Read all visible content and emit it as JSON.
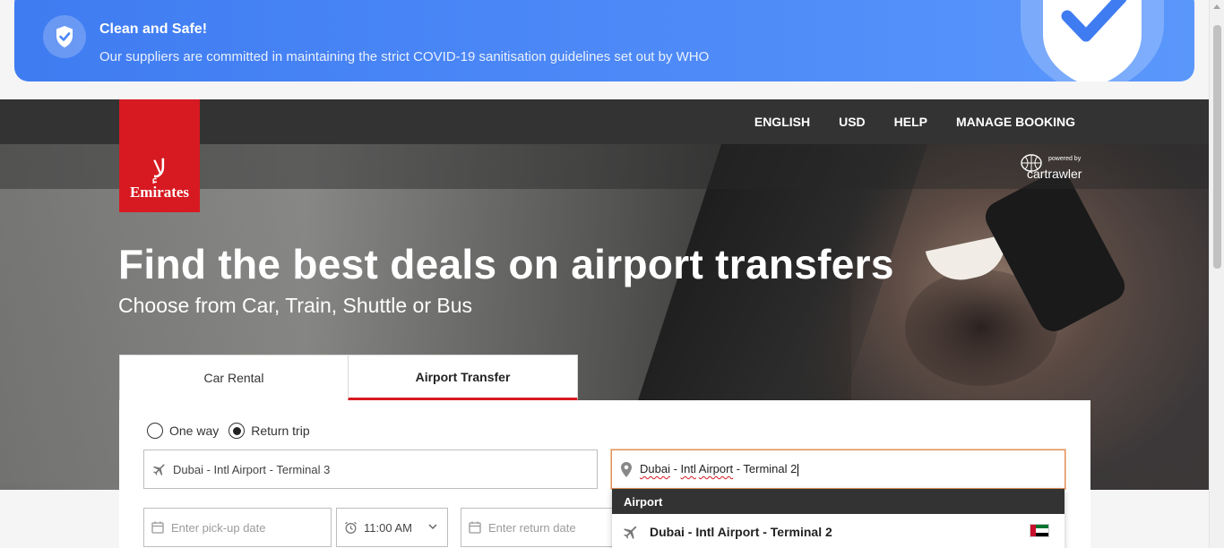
{
  "banner": {
    "title": "Clean and Safe!",
    "subtitle": "Our suppliers are committed in maintaining the strict COVID-19 sanitisation guidelines set out by WHO",
    "color": "#4a86f6"
  },
  "brand": {
    "logo_text": "Emirates",
    "logo_color": "#d71921",
    "powered_by": "powered by",
    "partner": "cartrawler"
  },
  "nav": {
    "items": [
      {
        "label": "ENGLISH"
      },
      {
        "label": "USD"
      },
      {
        "label": "HELP"
      },
      {
        "label": "MANAGE BOOKING"
      }
    ]
  },
  "hero": {
    "headline": "Find the best deals on airport transfers",
    "subheadline": "Choose from Car, Train, Shuttle or Bus"
  },
  "tabs": [
    {
      "label": "Car Rental",
      "active": false
    },
    {
      "label": "Airport Transfer",
      "active": true
    }
  ],
  "trip_type": {
    "options": [
      {
        "label": "One way",
        "selected": false
      },
      {
        "label": "Return trip",
        "selected": true
      }
    ]
  },
  "form": {
    "pickup_location": "Dubai - Intl Airport - Terminal 3",
    "dropoff_location": {
      "part1": "Dubai",
      "sep1": " - ",
      "part2": "Intl",
      "part3": "Airport",
      "rest": " - Terminal 2"
    },
    "pickup_date_placeholder": "Enter pick-up date",
    "pickup_time": "11:00 AM",
    "return_date_placeholder": "Enter return date"
  },
  "suggestions": {
    "group_label": "Airport",
    "items": [
      {
        "label": "Dubai - Intl Airport - Terminal 2",
        "flag": "uae-flag"
      }
    ]
  },
  "accent_color": "#d71921"
}
